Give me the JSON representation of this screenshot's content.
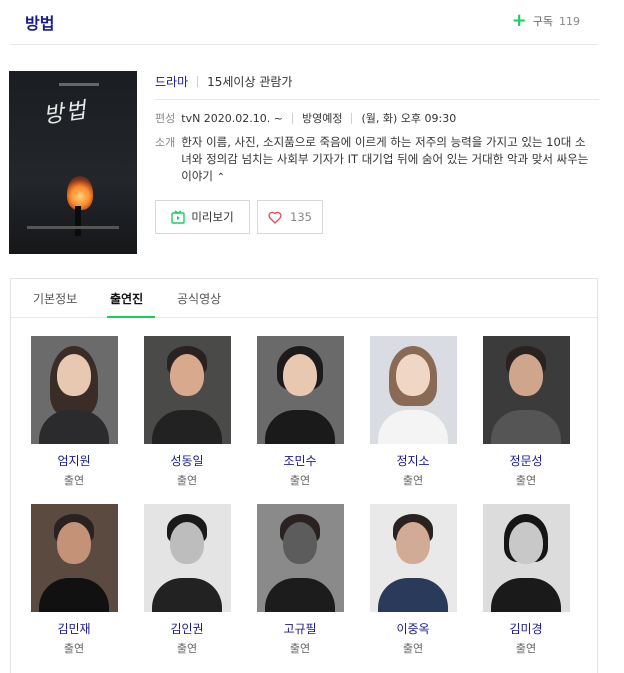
{
  "header": {
    "title": "방법",
    "subscribe_label": "구독",
    "subscribe_count": "119"
  },
  "info": {
    "genre": "드라마",
    "rating": "15세이상 관람가",
    "schedule_label": "편성",
    "network_date": "tvN 2020.02.10. ~",
    "status": "방영예정",
    "airtime": "(월, 화) 오후 09:30",
    "synopsis_label": "소개",
    "synopsis": "한자 이름, 사진, 소지품으로 죽음에 이르게 하는 저주의 능력을 가지고 있는 10대 소녀와 정의감 넘치는 사회부 기자가 IT 대기업 뒤에 숨어 있는 거대한 악과 맞서 싸우는 이야기",
    "preview_label": "미리보기",
    "like_count": "135"
  },
  "poster": {
    "title": "방법"
  },
  "tabs": [
    {
      "label": "기본정보"
    },
    {
      "label": "출연진"
    },
    {
      "label": "공식영상"
    }
  ],
  "cast": [
    {
      "name": "엄지원",
      "role": "출연"
    },
    {
      "name": "성동일",
      "role": "출연"
    },
    {
      "name": "조민수",
      "role": "출연"
    },
    {
      "name": "정지소",
      "role": "출연"
    },
    {
      "name": "정문성",
      "role": "출연"
    },
    {
      "name": "김민재",
      "role": "출연"
    },
    {
      "name": "김인권",
      "role": "출연"
    },
    {
      "name": "고규필",
      "role": "출연"
    },
    {
      "name": "이중옥",
      "role": "출연"
    },
    {
      "name": "김미경",
      "role": "출연"
    }
  ],
  "colors": {
    "accent_green": "#19ce60",
    "link_navy": "#1a1a8c"
  }
}
